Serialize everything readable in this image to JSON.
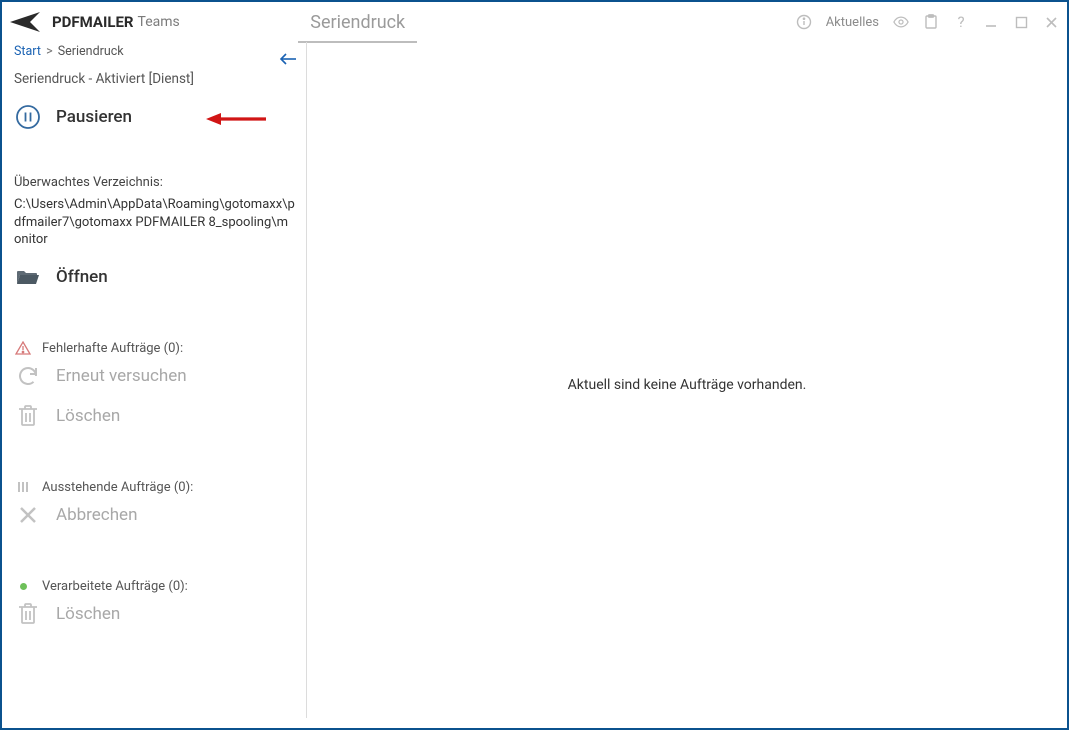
{
  "title": {
    "app": "PDFMAILER",
    "edition": "Teams",
    "center": "Seriendruck",
    "news": "Aktuelles"
  },
  "breadcrumb": {
    "start": "Start",
    "current": "Seriendruck"
  },
  "status": "Seriendruck - Aktiviert [Dienst]",
  "actions": {
    "pause": "Pausieren",
    "open": "Öffnen",
    "retry": "Erneut versuchen",
    "delete1": "Löschen",
    "cancel": "Abbrechen",
    "delete2": "Löschen"
  },
  "dir": {
    "label": "Überwachtes Verzeichnis:",
    "path": "C:\\Users\\Admin\\AppData\\Roaming\\gotomaxx\\pdfmailer7\\gotomaxx PDFMAILER 8_spooling\\monitor"
  },
  "sections": {
    "failed": "Fehlerhafte Aufträge (0):",
    "pending": "Ausstehende Aufträge (0):",
    "done": "Verarbeitete Aufträge (0):"
  },
  "main": {
    "empty": "Aktuell sind keine Aufträge vorhanden."
  }
}
